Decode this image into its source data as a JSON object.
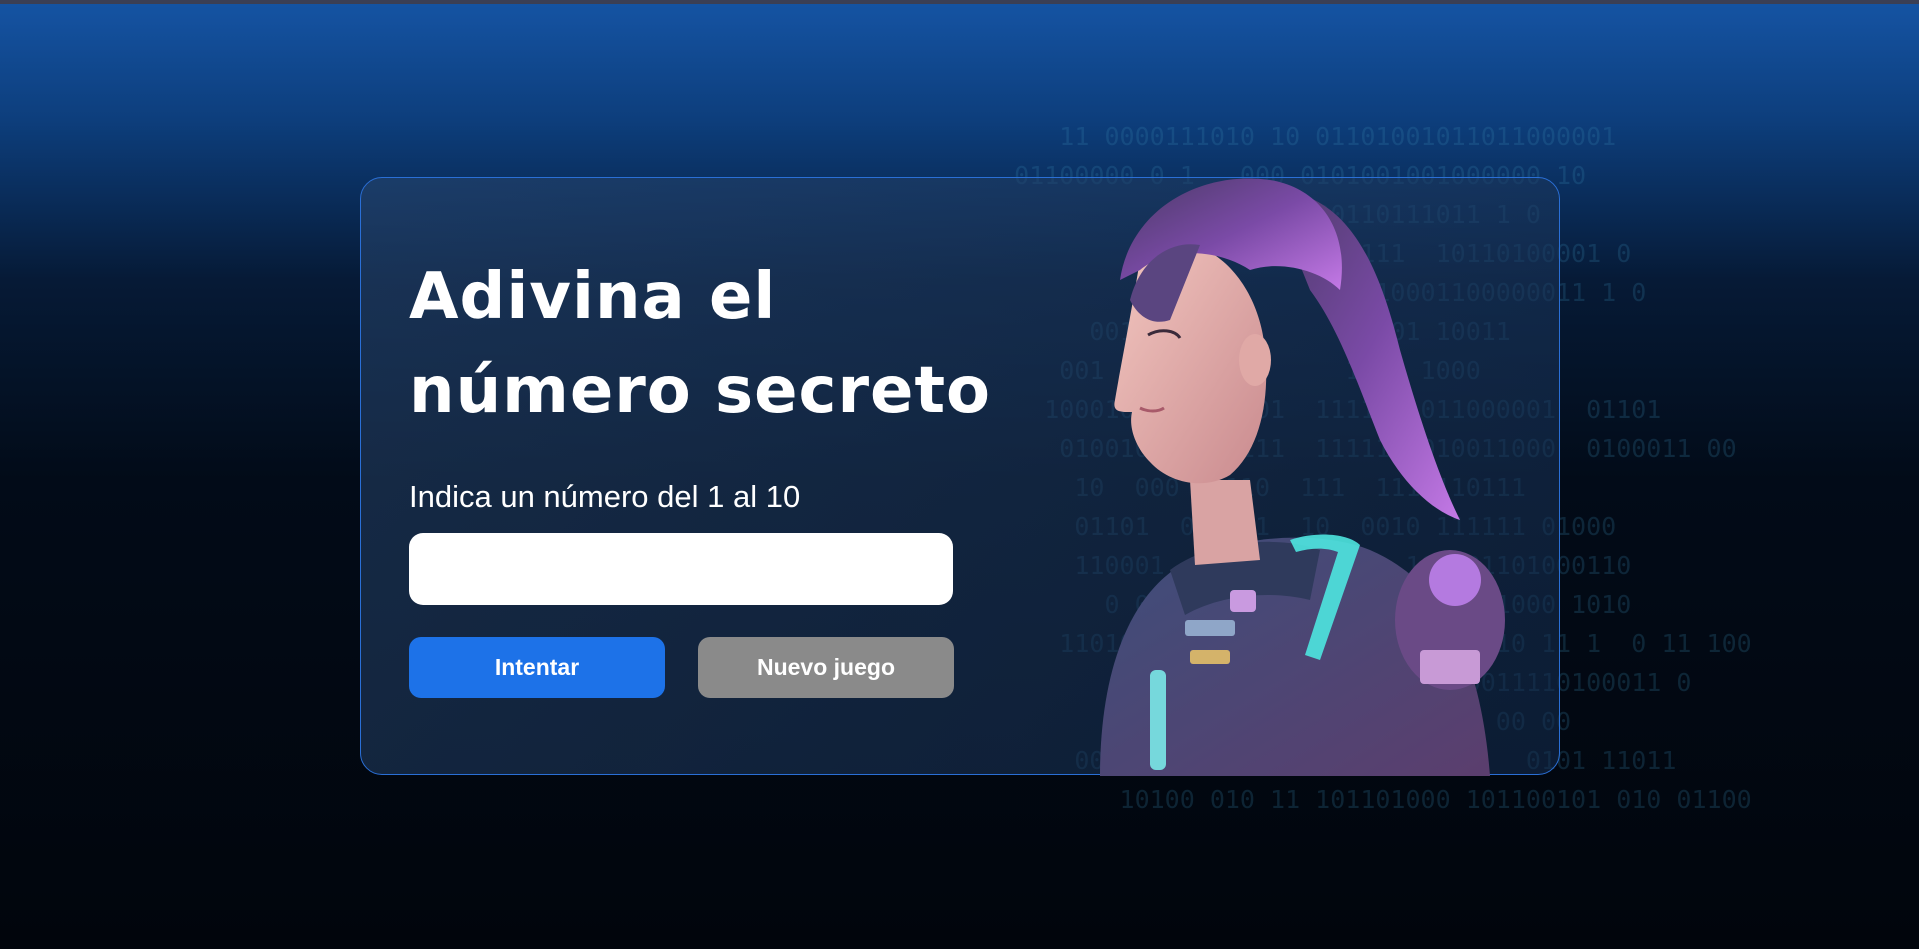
{
  "colors": {
    "accent": "#1d72e8",
    "secondary_button": "#8a8a8a",
    "card_border": "#2a6fd6",
    "hair": "#b066d6",
    "suit_glow": "#4ee6e0"
  },
  "header": {
    "title_line1": "Adivina el",
    "title_line2": "número secreto"
  },
  "form": {
    "prompt": "Indica un número del 1 al 10",
    "input_value": "",
    "input_placeholder": ""
  },
  "buttons": {
    "try_label": "Intentar",
    "new_game_label": "Nuevo juego"
  },
  "background": {
    "binary_rows": [
      "      11 0000111010 10 01101001011011000001",
      "   01100000 0 1   000 0101001001000000 10",
      "                  0011000110111011 1 0",
      "                    000101111  10110100001 0",
      "                       011010001100000011 1 0",
      "        001   0 1 1       1 01 10011",
      "      001   00  0        1011 1000",
      "     1000101   0 0101  111110 011000001  01101",
      "      0100100001  111  1111101010011000  0100011 00",
      "       10  000  1110  111  1111110111",
      "       01101  0101 1  10  0010 111111 01000",
      "       110001  1  0011  001  10 001101000110",
      "         0 000  0110  000 1  0010111000 1010",
      "      1101000 11100000 1 11  10 00010 11 1  0 11 100",
      "                                 0011110100011 0",
      "                                   00 00",
      "       00 0111                       0101 11011",
      "          10100 010 11 101101000 101100101 010 01100"
    ]
  }
}
